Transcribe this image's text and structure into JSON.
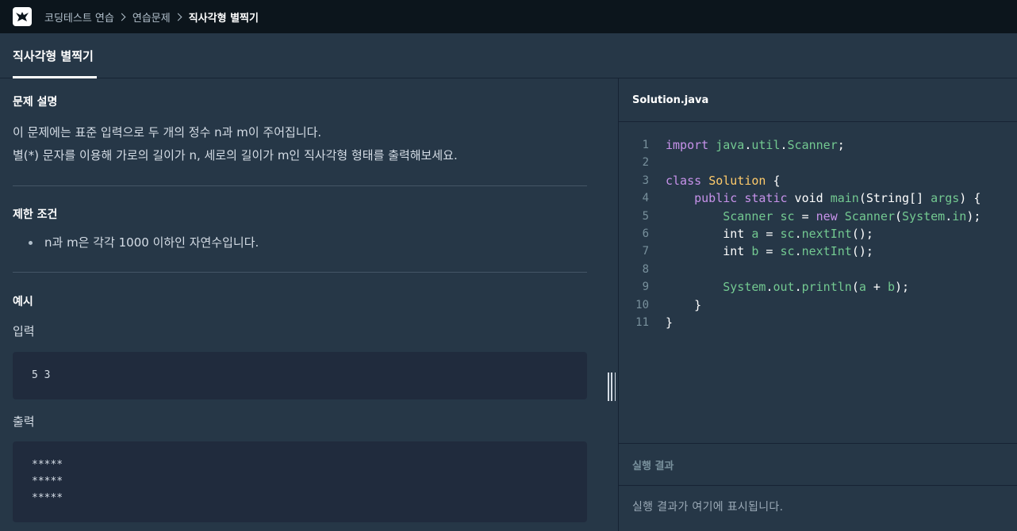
{
  "breadcrumb": {
    "items": [
      "코딩테스트 연습",
      "연습문제",
      "직사각형 별찍기"
    ]
  },
  "tab": {
    "label": "직사각형 별찍기"
  },
  "problem": {
    "description_title": "문제 설명",
    "description_lines": [
      "이 문제에는 표준 입력으로 두 개의 정수 n과 m이 주어집니다.",
      "별(*) 문자를 이용해 가로의 길이가 n, 세로의 길이가 m인 직사각형 형태를 출력해보세요."
    ],
    "constraints_title": "제한 조건",
    "constraints": [
      "n과 m은 각각 1000 이하인 자연수입니다."
    ],
    "example_title": "예시",
    "input_label": "입력",
    "input_lines": [
      "5 3"
    ],
    "output_label": "출력",
    "output_lines": [
      "*****",
      "*****",
      "*****"
    ]
  },
  "editor": {
    "filename": "Solution.java",
    "line_numbers": [
      "1",
      "2",
      "3",
      "4",
      "5",
      "6",
      "7",
      "8",
      "9",
      "10",
      "11"
    ]
  },
  "result": {
    "title": "실행 결과",
    "placeholder": "실행 결과가 여기에 표시됩니다."
  },
  "colors": {
    "topbar": "#0c151c",
    "background": "#263747",
    "codebox": "#202b3d",
    "keyword": "#c792ea",
    "type": "#ffcb6b",
    "identifier": "#73c991"
  }
}
